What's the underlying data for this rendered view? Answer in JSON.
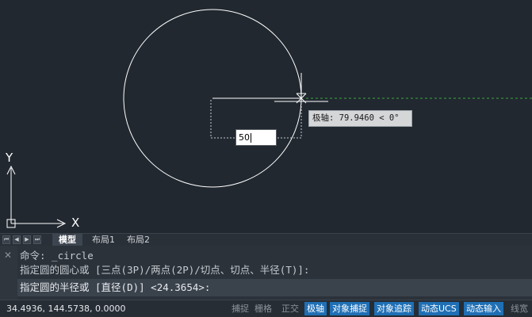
{
  "canvas": {
    "ucs_x_label": "X",
    "ucs_y_label": "Y",
    "tooltip_text": "极轴: 79.9460 < 0°",
    "dynamic_input_value": "50"
  },
  "tabs": {
    "items": [
      {
        "label": "模型",
        "active": true
      },
      {
        "label": "布局1",
        "active": false
      },
      {
        "label": "布局2",
        "active": false
      }
    ]
  },
  "command": {
    "history": [
      "命令: _circle",
      "指定圆的圆心或 [三点(3P)/两点(2P)/切点、切点、半径(T)]:"
    ],
    "prompt": "指定圆的半径或 [直径(D)] <24.3654>:"
  },
  "status": {
    "coords": "34.4936, 144.5738, 0.0000",
    "buttons": [
      {
        "label": "捕捉",
        "on": false
      },
      {
        "label": "栅格",
        "on": false
      },
      {
        "label": "正交",
        "on": false
      },
      {
        "label": "极轴",
        "on": true
      },
      {
        "label": "对象捕捉",
        "on": true
      },
      {
        "label": "对象追踪",
        "on": true
      },
      {
        "label": "动态UCS",
        "on": true
      },
      {
        "label": "动态输入",
        "on": true
      },
      {
        "label": "线宽",
        "on": false
      }
    ]
  },
  "colors": {
    "background": "#212830",
    "geometry": "#ffffff",
    "polar_tracking": "#3aa83a",
    "status_on": "#1f6fb5"
  }
}
